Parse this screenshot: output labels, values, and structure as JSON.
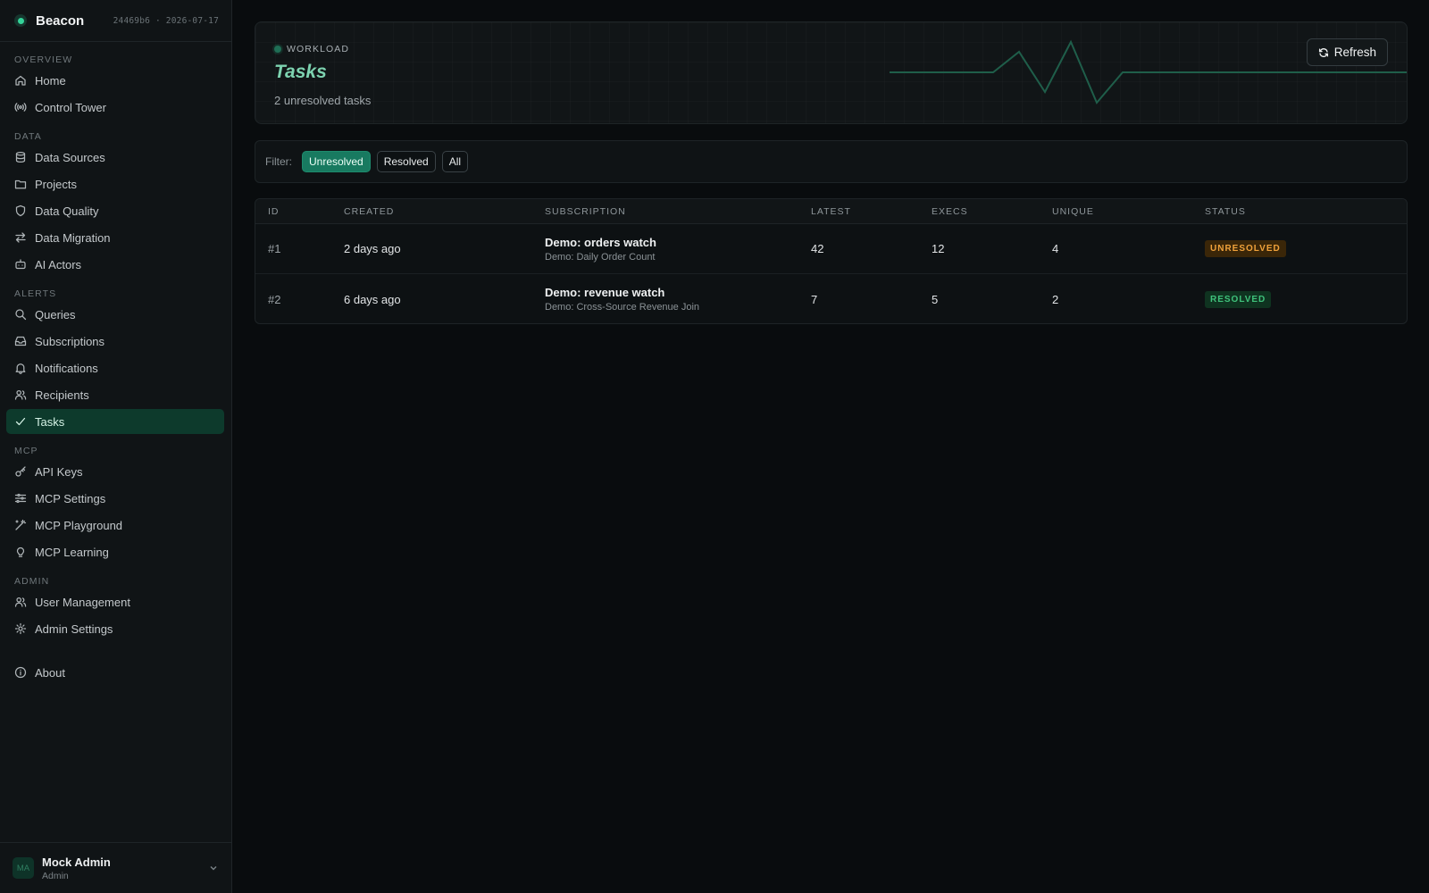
{
  "brand": {
    "name": "Beacon",
    "meta": "24469b6 · 2026-07-17"
  },
  "sidebar": {
    "sections": [
      {
        "label": "OVERVIEW",
        "items": [
          {
            "label": "Home",
            "icon": "home-icon"
          },
          {
            "label": "Control Tower",
            "icon": "broadcast-icon"
          }
        ]
      },
      {
        "label": "DATA",
        "items": [
          {
            "label": "Data Sources",
            "icon": "database-icon"
          },
          {
            "label": "Projects",
            "icon": "folder-icon"
          },
          {
            "label": "Data Quality",
            "icon": "shield-icon"
          },
          {
            "label": "Data Migration",
            "icon": "arrows-icon"
          },
          {
            "label": "AI Actors",
            "icon": "robot-icon"
          }
        ]
      },
      {
        "label": "ALERTS",
        "items": [
          {
            "label": "Queries",
            "icon": "search-icon"
          },
          {
            "label": "Subscriptions",
            "icon": "inbox-icon"
          },
          {
            "label": "Notifications",
            "icon": "bell-icon"
          },
          {
            "label": "Recipients",
            "icon": "users-icon"
          },
          {
            "label": "Tasks",
            "icon": "check-icon",
            "active": true
          }
        ]
      },
      {
        "label": "MCP",
        "items": [
          {
            "label": "API Keys",
            "icon": "key-icon"
          },
          {
            "label": "MCP Settings",
            "icon": "sliders-icon"
          },
          {
            "label": "MCP Playground",
            "icon": "wand-icon"
          },
          {
            "label": "MCP Learning",
            "icon": "lightbulb-icon"
          }
        ]
      },
      {
        "label": "ADMIN",
        "items": [
          {
            "label": "User Management",
            "icon": "users-icon"
          },
          {
            "label": "Admin Settings",
            "icon": "gear-icon"
          }
        ]
      }
    ],
    "about": {
      "label": "About",
      "icon": "info-icon"
    }
  },
  "user": {
    "initials": "MA",
    "name": "Mock Admin",
    "role": "Admin"
  },
  "hero": {
    "eyebrow": "WORKLOAD",
    "title": "Tasks",
    "subtitle": "2 unresolved tasks",
    "refresh_label": "Refresh"
  },
  "filter": {
    "label": "Filter:",
    "options": [
      {
        "label": "Unresolved",
        "active": true
      },
      {
        "label": "Resolved",
        "active": false
      },
      {
        "label": "All",
        "active": false
      }
    ]
  },
  "table": {
    "headers": [
      "ID",
      "CREATED",
      "SUBSCRIPTION",
      "LATEST",
      "EXECS",
      "UNIQUE",
      "STATUS"
    ],
    "rows": [
      {
        "id": "#1",
        "created": "2 days ago",
        "sub_title": "Demo: orders watch",
        "sub_desc": "Demo: Daily Order Count",
        "latest": "42",
        "execs": "12",
        "unique": "4",
        "status": "UNRESOLVED",
        "status_kind": "unresolved"
      },
      {
        "id": "#2",
        "created": "6 days ago",
        "sub_title": "Demo: revenue watch",
        "sub_desc": "Demo: Cross-Source Revenue Join",
        "latest": "7",
        "execs": "5",
        "unique": "2",
        "status": "RESOLVED",
        "status_kind": "resolved"
      }
    ]
  },
  "colors": {
    "accent": "#34d399",
    "active_nav_bg": "#0d3a2c",
    "title_green": "#7dd3b0",
    "unresolved": "#f0a23b",
    "resolved": "#3fc27b"
  }
}
